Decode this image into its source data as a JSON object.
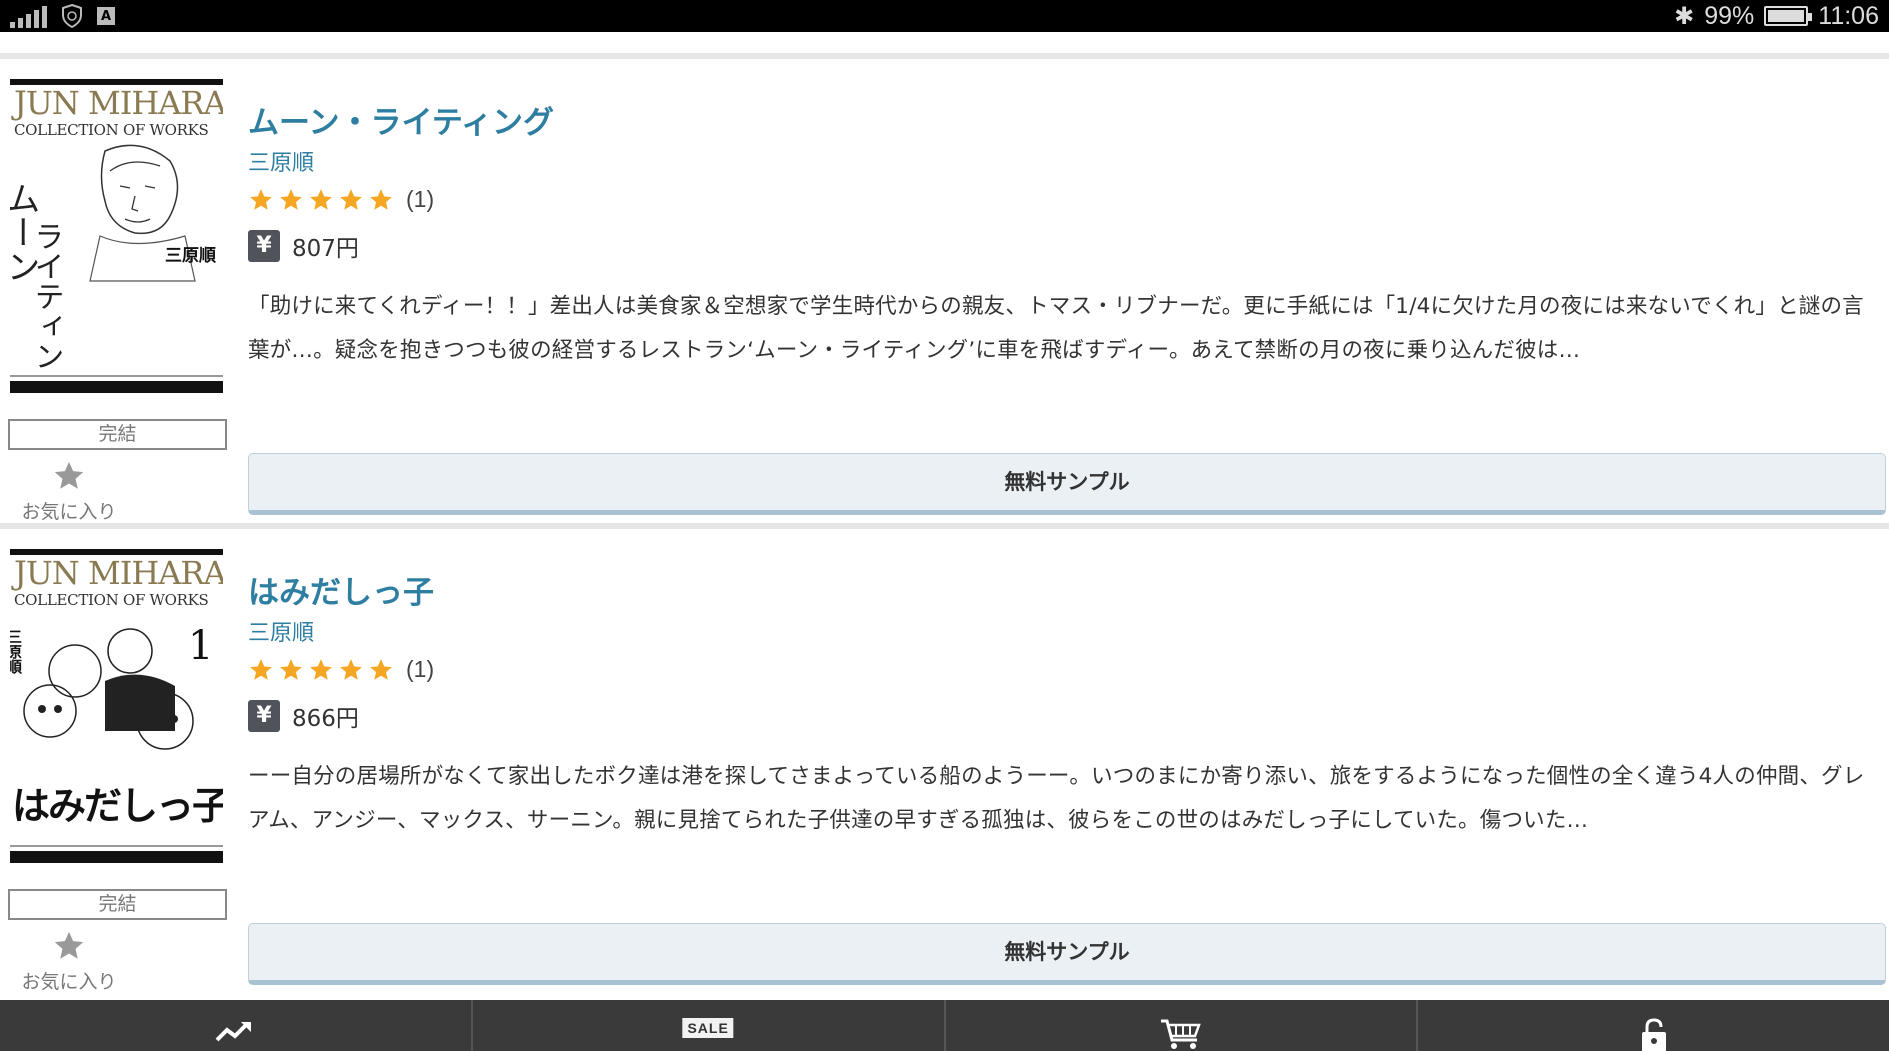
{
  "status_bar": {
    "battery": "99%",
    "time": "11:06",
    "battery_level": 0.99
  },
  "items": [
    {
      "cover_series": "JUN MIHARA",
      "cover_sub": "COLLECTION OF WORKS",
      "title": "ムーン・ライティング",
      "author": "三原順",
      "rating_count": "(1)",
      "rating_stars": 5,
      "price_icon": "¥",
      "price": "807円",
      "description": "「助けに来てくれディー！！」差出人は美食家＆空想家で学生時代からの親友、トマス・リブナーだ。更に手紙には「1/4に欠けた月の夜には来ないでくれ」と謎の言葉が…。疑念を抱きつつも彼の経営するレストラン‘ムーン・ライティング’に車を飛ばすディー。あえて禁断の月の夜に乗り込んだ彼は…",
      "status": "完結",
      "favorite_label": "お気に入り",
      "sample_label": "無料サンプル"
    },
    {
      "cover_series": "JUN MIHARA",
      "cover_sub": "COLLECTION OF WORKS",
      "title": "はみだしっ子",
      "author": "三原順",
      "rating_count": "(1)",
      "rating_stars": 5,
      "price_icon": "¥",
      "price": "866円",
      "description": "ーー自分の居場所がなくて家出したボク達は港を探してさまよっている船のようーー。いつのまにか寄り添い、旅をするようになった個性の全く違う4人の仲間、グレアム、アンジー、マックス、サーニン。親に見捨てられた子供達の早すぎる孤独は、彼らをこの世のはみだしっ子にしていた。傷ついた…",
      "status": "完結",
      "favorite_label": "お気に入り",
      "sample_label": "無料サンプル"
    }
  ],
  "bottom_nav": {
    "items": [
      {
        "icon": "trending-icon"
      },
      {
        "icon": "sale-icon",
        "label": "SALE"
      },
      {
        "icon": "cart-icon"
      },
      {
        "icon": "lock-icon"
      }
    ]
  },
  "colors": {
    "accent": "#2d7ea0",
    "star": "#f5a623",
    "nav_bg": "#3a3a3a",
    "button_bg": "#eaf0f4"
  }
}
